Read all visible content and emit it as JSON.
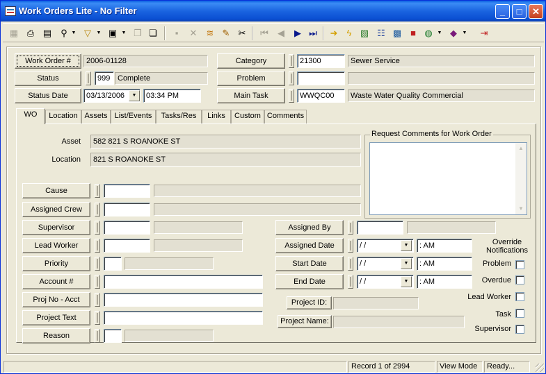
{
  "window": {
    "title": "Work Orders Lite - No Filter",
    "minimize_glyph": "_",
    "maximize_glyph": "□",
    "close_glyph": "✕"
  },
  "toolbar": {
    "icons": [
      "new-record-icon",
      "print-icon",
      "print-preview-icon",
      "search-icon",
      "filter-icon",
      "report-icon",
      "copy-record-icon",
      "duplicate-icon",
      "save-icon",
      "delete-icon",
      "stack-icon",
      "edit-pencil-icon",
      "cut-icon",
      "first-record-icon",
      "previous-record-icon",
      "next-record-icon",
      "last-record-icon",
      "arrow-right-icon",
      "lightning-icon",
      "map-icon",
      "hierarchy-icon",
      "screen-icon",
      "truck-icon",
      "globe-icon",
      "book-icon",
      "exit-icon"
    ]
  },
  "header": {
    "work_order_label": "Work Order #",
    "work_order_value": "2006-01128",
    "status_label": "Status",
    "status_code": "999",
    "status_desc": "Complete",
    "status_date_label": "Status Date",
    "status_date": "03/13/2006",
    "status_time": "03:34 PM",
    "category_label": "Category",
    "category_code": "21300",
    "category_desc": "Sewer Service",
    "problem_label": "Problem",
    "problem_code": "",
    "problem_desc": "",
    "main_task_label": "Main Task",
    "main_task_code": "WWQC00",
    "main_task_desc": "Waste Water Quality Commercial"
  },
  "tabs": [
    {
      "label": "WO",
      "active": true
    },
    {
      "label": "Location"
    },
    {
      "label": "Assets"
    },
    {
      "label": "List/Events"
    },
    {
      "label": "Tasks/Res"
    },
    {
      "label": "Links"
    },
    {
      "label": "Custom"
    },
    {
      "label": "Comments"
    }
  ],
  "wo": {
    "asset_label": "Asset",
    "asset_value": "582 821 S ROANOKE ST",
    "location_label": "Location",
    "location_value": "821 S ROANOKE ST",
    "request_comments_label": "Request Comments for Work Order",
    "cause_label": "Cause",
    "assigned_crew_label": "Assigned Crew",
    "supervisor_label": "Supervisor",
    "lead_worker_label": "Lead Worker",
    "priority_label": "Priority",
    "account_label": "Account #",
    "proj_no_label": "Proj No - Acct",
    "project_text_label": "Project Text",
    "reason_label": "Reason",
    "assigned_by_label": "Assigned By",
    "assigned_date_label": "Assigned Date",
    "assigned_date_value": " / /",
    "assigned_time_value": " :  AM",
    "start_date_label": "Start Date",
    "start_date_value": " / /",
    "start_time_value": " :  AM",
    "end_date_label": "End Date",
    "end_date_value": " / /",
    "end_time_value": " :  AM",
    "project_id_label": "Project ID:",
    "project_name_label": "Project Name:",
    "override_title": "Override Notifications",
    "override_items": [
      "Problem",
      "Overdue",
      "Lead Worker",
      "Task",
      "Supervisor"
    ]
  },
  "status_bar": {
    "record": "Record 1 of 2994",
    "mode": "View Mode",
    "state": "Ready..."
  }
}
